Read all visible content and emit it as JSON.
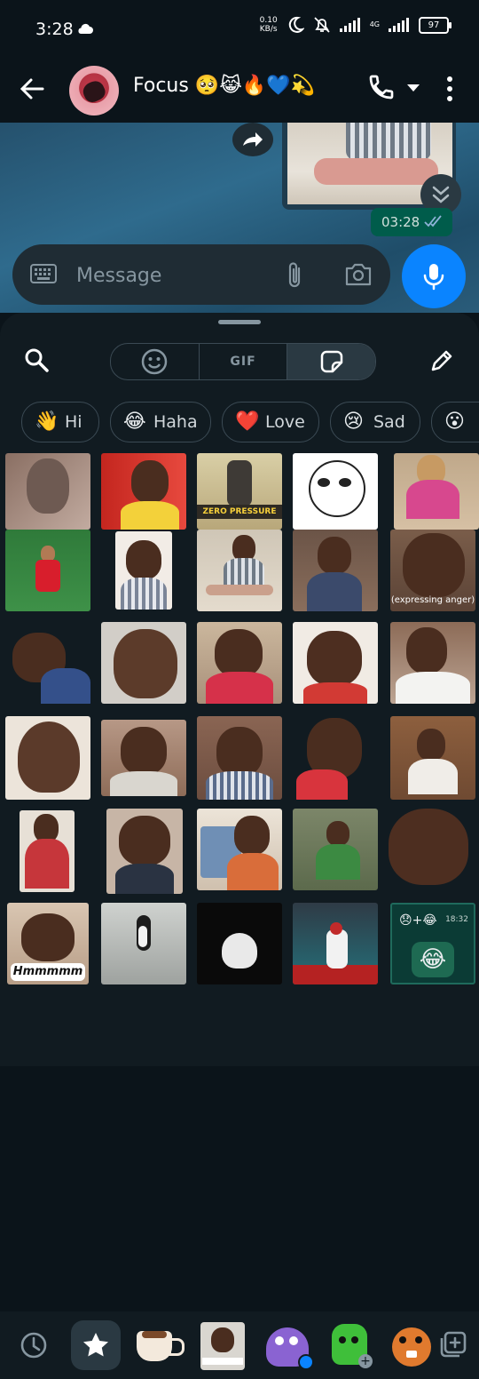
{
  "status_bar": {
    "time": "3:28",
    "net_speed_top": "0.10",
    "net_speed_unit": "KB/s",
    "network_label": "4G",
    "battery": "97",
    "icons": [
      "cloud-icon",
      "moon-icon",
      "bell-off-icon",
      "signal-icon",
      "battery-icon"
    ]
  },
  "header": {
    "title": "Focus 🥺😹🔥💙💫",
    "icons": [
      "back-arrow-icon",
      "phone-icon",
      "caret-down-icon",
      "more-vert-icon"
    ]
  },
  "chat": {
    "message_time": "03:28",
    "input_placeholder": "Message",
    "icons": [
      "forward-icon",
      "scroll-down-icon",
      "double-check-icon",
      "keyboard-icon",
      "attach-icon",
      "camera-icon",
      "mic-icon"
    ]
  },
  "panel": {
    "tabs": [
      {
        "label": "",
        "icon": "emoji-icon"
      },
      {
        "label": "GIF",
        "icon": ""
      },
      {
        "label": "",
        "icon": "sticker-icon",
        "selected": true
      }
    ],
    "chips": [
      {
        "emoji": "👋",
        "label": "Hi"
      },
      {
        "emoji": "😂",
        "label": "Haha"
      },
      {
        "emoji": "❤️",
        "label": "Love"
      },
      {
        "emoji": "😢",
        "label": "Sad"
      },
      {
        "emoji": "😮",
        "label": ""
      }
    ],
    "sticker_captions": {
      "zero_pressure": "ZERO PRESSURE",
      "expressing_anger": "(expressing anger)",
      "hmmmmm": "Hmmmmm",
      "chat_time": "18:32"
    },
    "tray_icons": [
      "recent-icon",
      "favorites-star-icon",
      "coffee-cup-sticker",
      "pack-sticker",
      "monster-sticker",
      "hand-sticker",
      "beaver-sticker",
      "add-sticker-icon"
    ]
  },
  "colors": {
    "background": "#0b141a",
    "panel": "#111b21",
    "accent_mic": "#0a84ff",
    "outgoing_bubble": "#005c4b"
  }
}
